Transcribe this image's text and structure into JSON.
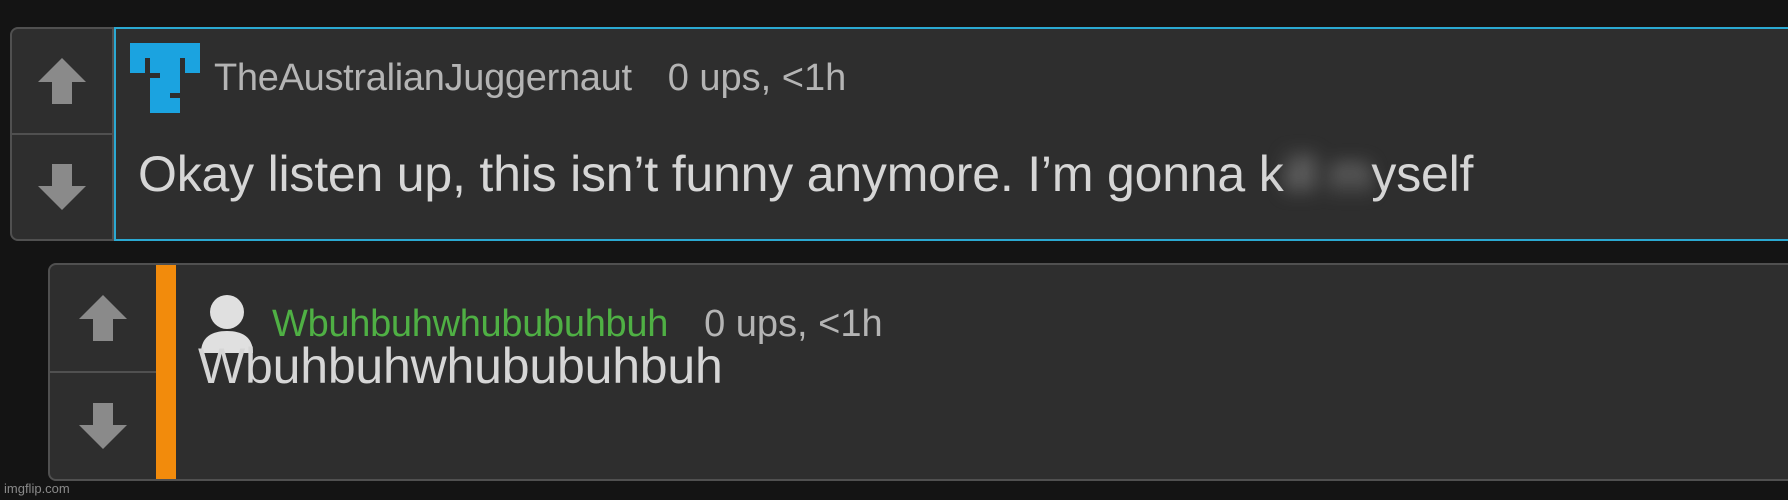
{
  "thread": {
    "parent": {
      "username": "TheAustralianJuggernaut",
      "meta": "0 ups, <1h",
      "text_before": "Okay listen up, this isn’t funny anymore. I’m gonna k",
      "text_censored": "ill m",
      "text_after": "yself",
      "avatar_icon": "pixel-logo-icon",
      "upvote_icon": "arrow-up-icon",
      "downvote_icon": "arrow-down-icon",
      "highlight_color": "#2ba9d2"
    },
    "reply": {
      "username": "Wbuhbuhwhububuhbuh",
      "meta": "0 ups, <1h",
      "text": "Wbuhbuhwhububuhbuh",
      "avatar_icon": "default-user-icon",
      "upvote_icon": "arrow-up-icon",
      "downvote_icon": "arrow-down-icon",
      "username_color": "#4fb044",
      "thread_bar_color": "#f28b0c"
    }
  },
  "watermark": "imgflip.com"
}
